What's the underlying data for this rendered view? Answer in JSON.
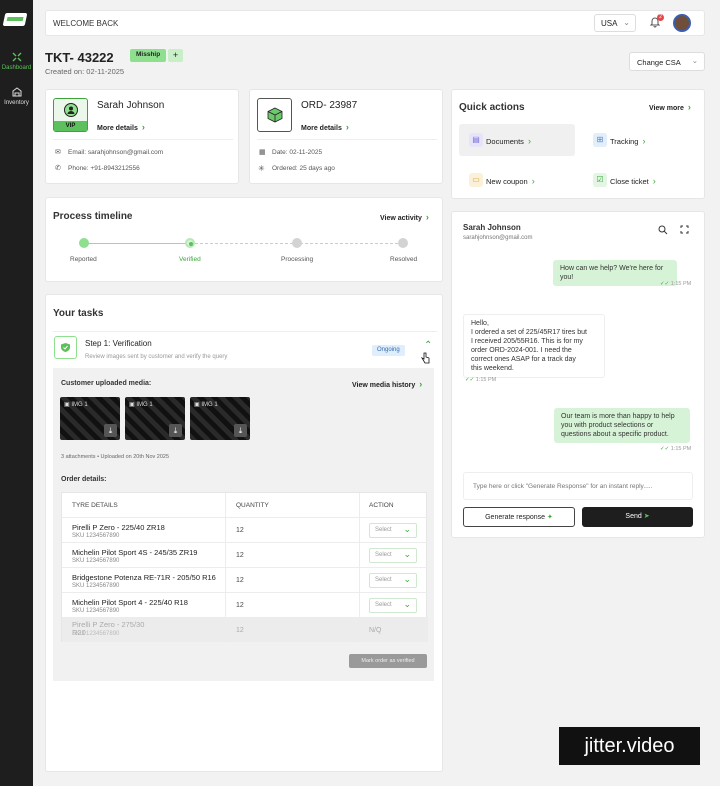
{
  "sidebar": {
    "items": [
      {
        "label": "Dashboard",
        "icon": "dashboard-icon",
        "active": true
      },
      {
        "label": "Inventory",
        "icon": "warehouse-icon",
        "active": false
      }
    ]
  },
  "header": {
    "welcome": "WELCOME BACK",
    "region": "USA",
    "notification_count": "2"
  },
  "ticket": {
    "id": "TKT- 43222",
    "tag": "Misship",
    "add_label": "+",
    "created": "Created on: 02-11-2025",
    "change_csa": "Change CSA"
  },
  "customer": {
    "name": "Sarah Johnson",
    "badge": "VIP",
    "more": "More details",
    "email": "Email: sarahjohnson@gmail.com",
    "phone": "Phone: +91-8943212556"
  },
  "order": {
    "id": "ORD- 23987",
    "more": "More details",
    "date": "Date: 02-11-2025",
    "ordered": "Ordered: 25 days ago"
  },
  "timeline": {
    "title": "Process timeline",
    "link": "View activity",
    "steps": [
      {
        "label": "Reported",
        "state": "done"
      },
      {
        "label": "Verified",
        "state": "current"
      },
      {
        "label": "Processing",
        "state": "pending"
      },
      {
        "label": "Resolved",
        "state": "pending"
      }
    ]
  },
  "quick_actions": {
    "title": "Quick actions",
    "view_more": "View more",
    "items": [
      {
        "label": "Documents",
        "icon": "document-icon",
        "color": "#7b6fd6"
      },
      {
        "label": "Tracking",
        "icon": "map-icon",
        "color": "#4a86c8"
      },
      {
        "label": "New coupon",
        "icon": "coupon-icon",
        "color": "#d9a23a"
      },
      {
        "label": "Close ticket",
        "icon": "checkbox-icon",
        "color": "#3ba53b"
      }
    ]
  },
  "tasks": {
    "title": "Your tasks",
    "step_title": "Step 1: Verification",
    "step_sub": "Review images sent by customer and verify the query",
    "status": "Ongoing",
    "media_label": "Customer uploaded media:",
    "media_link": "View media history",
    "media": [
      {
        "label": "IMG 1"
      },
      {
        "label": "IMG 1"
      },
      {
        "label": "IMG 1"
      }
    ],
    "attachments": "3 attachments  •  Uploaded on 20th Nov 2025",
    "order_details": "Order details:",
    "columns": [
      "TYRE DETAILS",
      "QUANTITY",
      "ACTION"
    ],
    "rows": [
      {
        "name": "Pirelli P Zero - 225/40 ZR18",
        "sku": "SKU 1234567890",
        "qty": "12",
        "action": "Select"
      },
      {
        "name": "Michelin Pilot Sport 4S - 245/35 ZR19",
        "sku": "SKU 1234567890",
        "qty": "12",
        "action": "Select"
      },
      {
        "name": "Bridgestone Potenza RE-71R - 205/50 R16",
        "sku": "SKU 1234567890",
        "qty": "12",
        "action": "Select"
      },
      {
        "name": "Michelin Pilot Sport 4 - 225/40 R18",
        "sku": "SKU 1234567890",
        "qty": "12",
        "action": "Select"
      },
      {
        "name": "Pirelli P Zero - 275/30",
        "name2": "R20",
        "sku": "SKU 1234567890",
        "qty": "12",
        "action": "N/Q"
      }
    ],
    "mark_button": "Mark order as verified"
  },
  "chat": {
    "name": "Sarah Johnson",
    "email": "sarahjohnson@gmail.com",
    "messages": [
      {
        "from": "agent",
        "lines": [
          "How can we help? We're here for",
          "you!"
        ],
        "time": "1:15 PM"
      },
      {
        "from": "customer",
        "lines": [
          "Hello,",
          "I ordered a set of 225/45R17 tires but",
          "I received 205/55R16. This is for my",
          "order ORD-2024-001. I need the",
          "correct ones ASAP for a track day",
          "this weekend."
        ],
        "time": "1:15 PM"
      },
      {
        "from": "agent",
        "lines": [
          "Our team is more than happy to help",
          "you with product selections or",
          "questions about a specific product."
        ],
        "time": "1:15 PM"
      }
    ],
    "placeholder": "Type here or click \"Generate Response\" for an instant reply.....",
    "generate": "Generate response",
    "send": "Send"
  },
  "watermark": "jitter.video",
  "colors": {
    "accent": "#3ba53b",
    "sidebar": "#1e1e1e",
    "tag": "#8ee08e"
  }
}
